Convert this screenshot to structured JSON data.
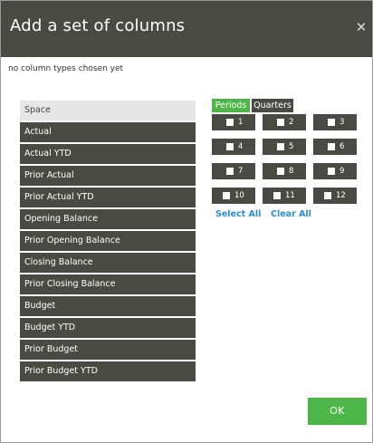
{
  "dialog": {
    "title": "Add a set of columns",
    "close_symbol": "✕",
    "status": "no column types chosen yet",
    "ok_label": "OK"
  },
  "column_types": [
    "Space",
    "Actual",
    "Actual YTD",
    "Prior Actual",
    "Prior Actual YTD",
    "Opening Balance",
    "Prior Opening Balance",
    "Closing Balance",
    "Prior Closing Balance",
    "Budget",
    "Budget YTD",
    "Prior Budget",
    "Prior Budget YTD"
  ],
  "tabs": {
    "periods": "Periods",
    "quarters": "Quarters",
    "active": "Periods"
  },
  "periods": [
    "1",
    "2",
    "3",
    "4",
    "5",
    "6",
    "7",
    "8",
    "9",
    "10",
    "11",
    "12"
  ],
  "links": {
    "select_all": "Select All",
    "clear_all": "Clear All"
  },
  "colors": {
    "header": "#4a4a44",
    "accent": "#4cb748",
    "link": "#2b8ed6",
    "selected_item": "#e6e6e6"
  }
}
